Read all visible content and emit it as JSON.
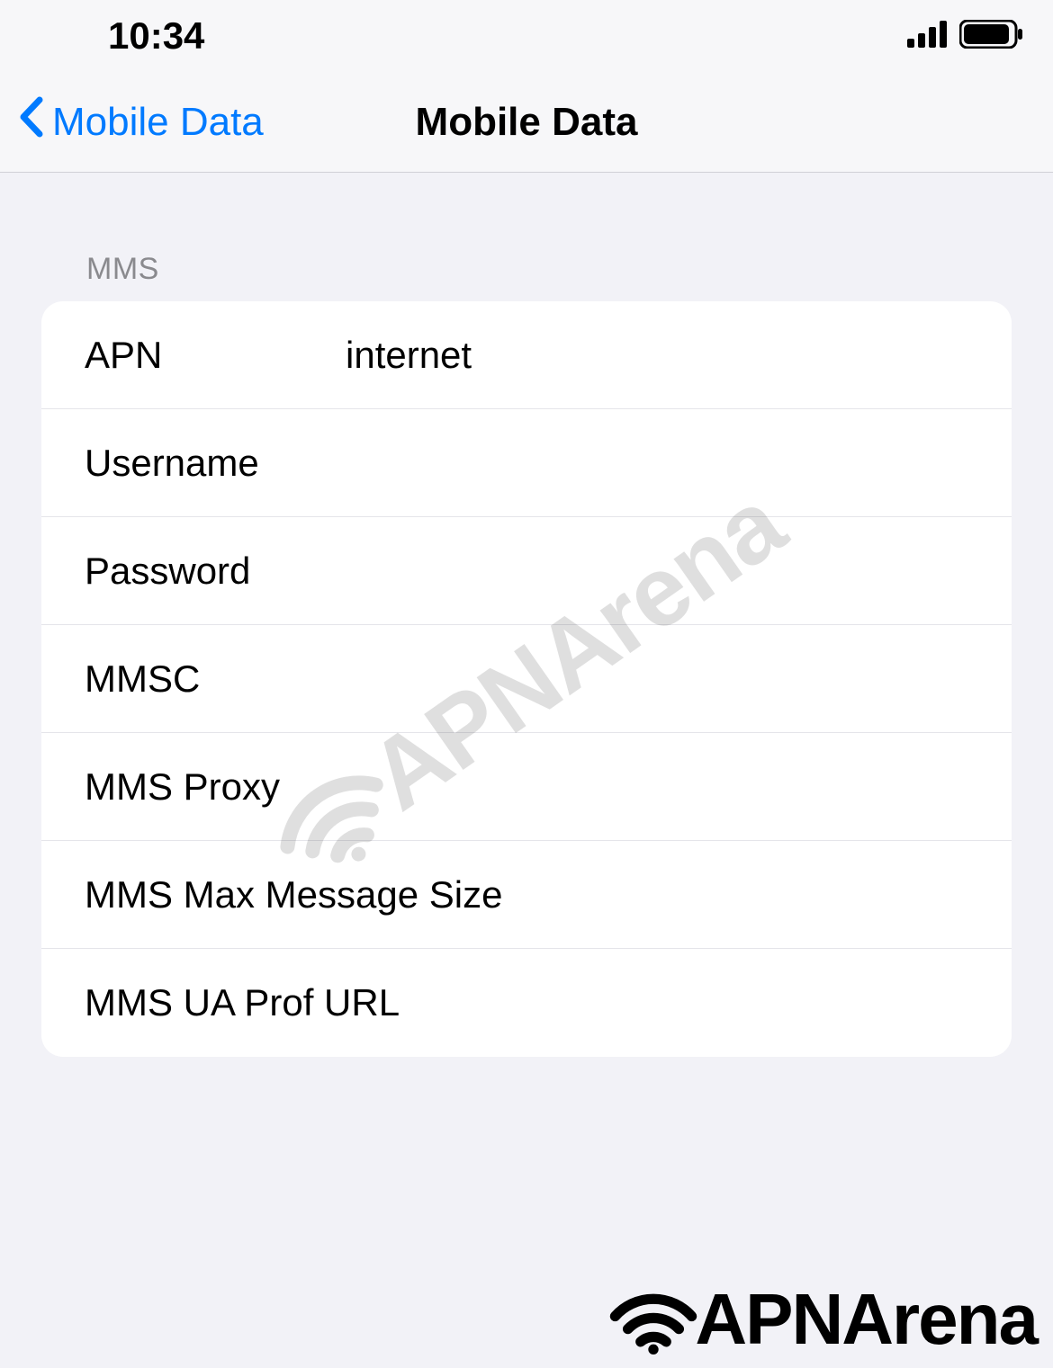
{
  "status": {
    "time": "10:34"
  },
  "nav": {
    "back_label": "Mobile Data",
    "title": "Mobile Data"
  },
  "section": {
    "header": "MMS"
  },
  "fields": {
    "apn": {
      "label": "APN",
      "value": "internet"
    },
    "username": {
      "label": "Username",
      "value": ""
    },
    "password": {
      "label": "Password",
      "value": ""
    },
    "mmsc": {
      "label": "MMSC",
      "value": ""
    },
    "mms_proxy": {
      "label": "MMS Proxy",
      "value": ""
    },
    "mms_max": {
      "label": "MMS Max Message Size",
      "value": ""
    },
    "mms_ua": {
      "label": "MMS UA Prof URL",
      "value": ""
    }
  },
  "brand": {
    "name": "APNArena"
  }
}
